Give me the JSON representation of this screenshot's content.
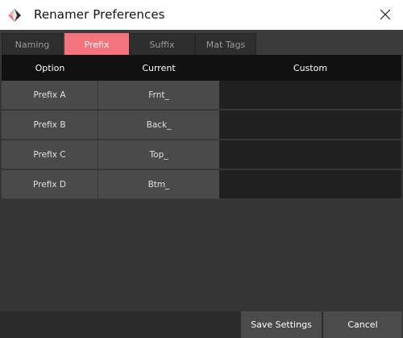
{
  "window": {
    "title": "Renamer Preferences",
    "close_glyph": "✕"
  },
  "tabs": [
    {
      "label": "Naming",
      "active": false
    },
    {
      "label": "Prefix",
      "active": true
    },
    {
      "label": "Suffix",
      "active": false
    },
    {
      "label": "Mat Tags",
      "active": false
    }
  ],
  "table": {
    "headers": {
      "option": "Option",
      "current": "Current",
      "custom": "Custom"
    },
    "rows": [
      {
        "option": "Prefix A",
        "current": "Frnt_",
        "custom": ""
      },
      {
        "option": "Prefix B",
        "current": "Back_",
        "custom": ""
      },
      {
        "option": "Prefix C",
        "current": "Top_",
        "custom": ""
      },
      {
        "option": "Prefix D",
        "current": "Btm_",
        "custom": ""
      }
    ]
  },
  "footer": {
    "save_label": "Save Settings",
    "cancel_label": "Cancel"
  },
  "colors": {
    "accent": "#f4737c",
    "header_bg": "#111111",
    "cell_bg": "#4a4a4a",
    "custom_bg": "#202020"
  }
}
